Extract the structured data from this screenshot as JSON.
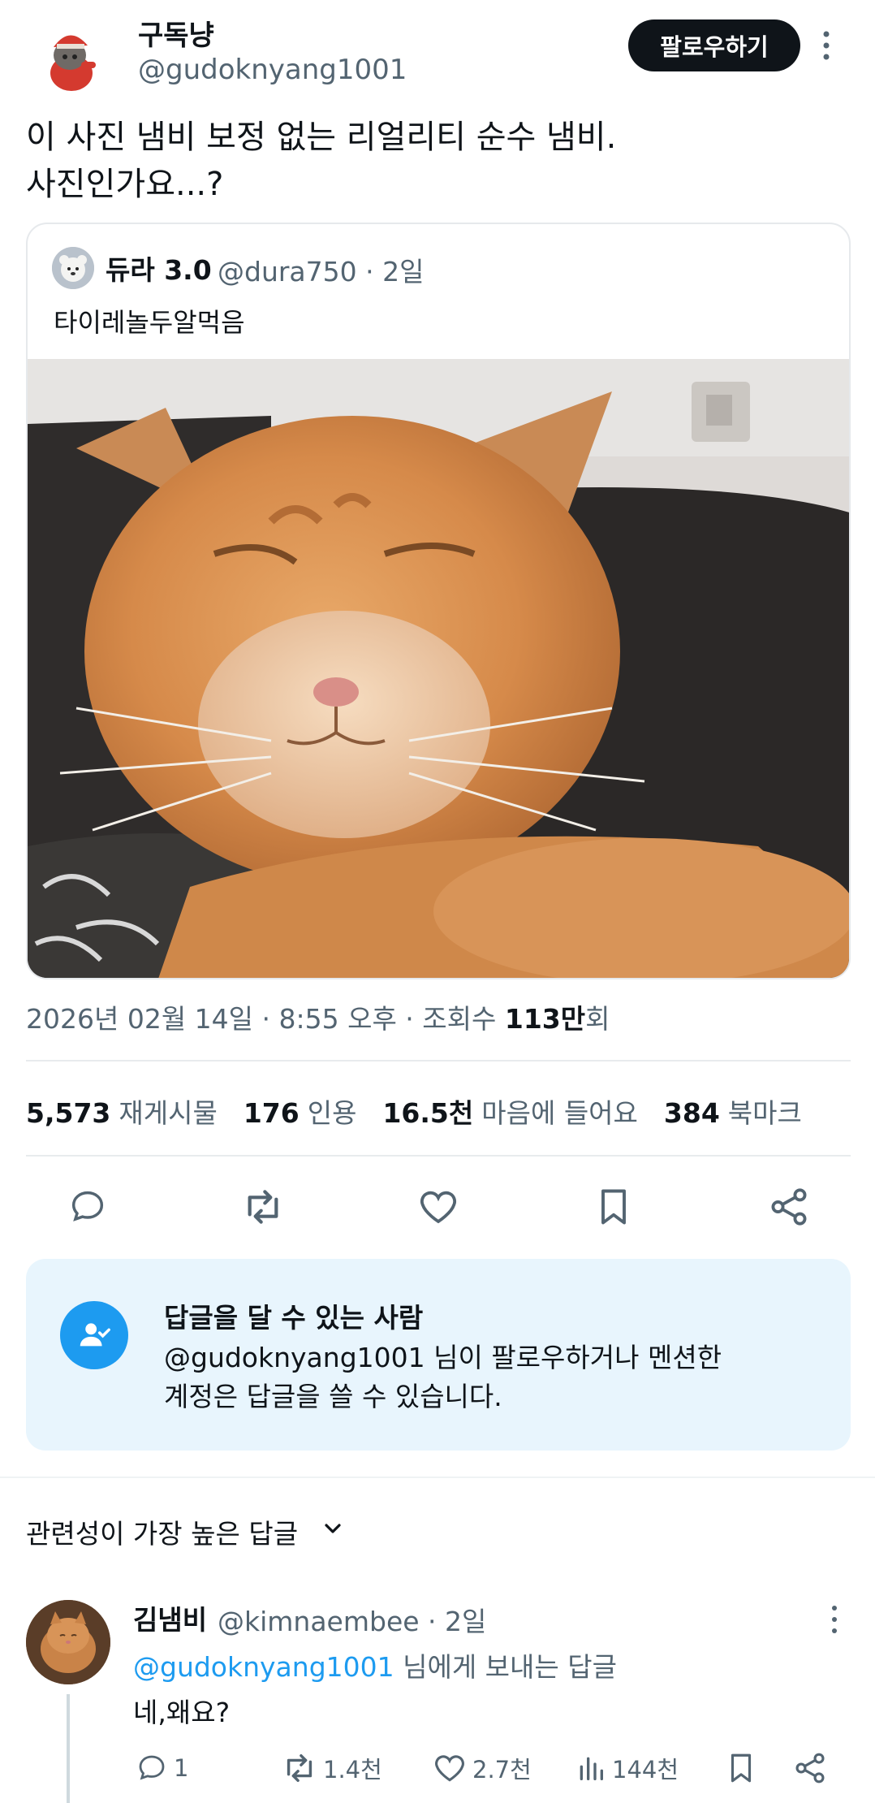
{
  "tweet": {
    "author_name": "구독냥",
    "author_handle": "@gudoknyang1001",
    "follow_label": "팔로우하기",
    "text": "이 사진 냄비 보정 없는 리얼리티 순수 냄비.\n사진인가요...?",
    "timestamp_prefix": "2026년 02월 14일 · 8:55 오후 · 조회수 ",
    "views_value": "113만",
    "views_suffix": "회"
  },
  "quote": {
    "author_name": "듀라 3.0",
    "meta": "@dura750 · 2일",
    "text": "타이레놀두알먹음"
  },
  "stats": [
    {
      "num": "5,573",
      "label": "재게시물"
    },
    {
      "num": "176",
      "label": "인용"
    },
    {
      "num": "16.5천",
      "label": "마음에 들어요"
    },
    {
      "num": "384",
      "label": "북마크"
    }
  ],
  "actions": [
    "reply-icon",
    "repost-icon",
    "like-icon",
    "bookmark-icon",
    "share-icon"
  ],
  "reply_restriction": {
    "title": "답글을 달 수 있는 사람",
    "body": "@gudoknyang1001 님이 팔로우하거나 멘션한 계정은 답글을 쓸 수 있습니다."
  },
  "sort": {
    "label": "관련성이 가장 높은 답글"
  },
  "reply": {
    "author_name": "김냄비",
    "meta": "@kimnaembee · 2일",
    "reply_to_mention": "@gudoknyang1001",
    "reply_to_suffix": " 님에게 보내는 답글",
    "text": "네,왜요?",
    "replies": "1",
    "reposts": "1.4천",
    "likes": "2.7천",
    "views": "144천"
  },
  "colors": {
    "accent": "#1d9bf0",
    "text_primary": "#0f1419",
    "text_secondary": "#536471",
    "reply_box_bg": "#e8f5fd"
  }
}
